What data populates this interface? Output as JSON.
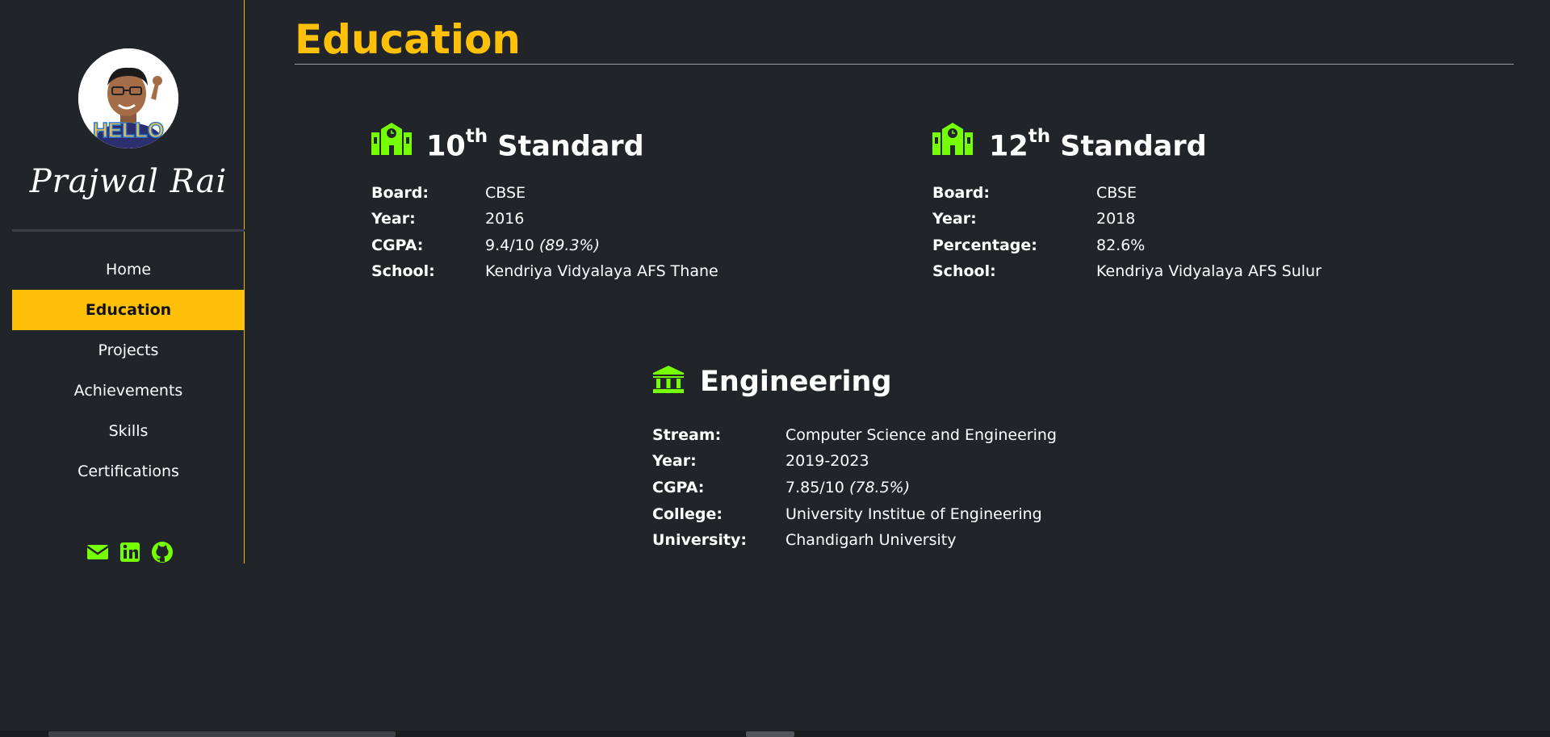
{
  "sidebar": {
    "name": "Prajwal Rai",
    "avatar_label": "HELLO",
    "nav": [
      {
        "label": "Home"
      },
      {
        "label": "Education"
      },
      {
        "label": "Projects"
      },
      {
        "label": "Achievements"
      },
      {
        "label": "Skills"
      },
      {
        "label": "Certifications"
      }
    ],
    "active_nav": "Education",
    "social_icons": [
      "envelope-icon",
      "linkedin-icon",
      "github-icon"
    ]
  },
  "page": {
    "title": "Education"
  },
  "education": {
    "tenth": {
      "title_number": "10",
      "title_sup": "th",
      "title_rest": " Standard",
      "rows": [
        {
          "label": "Board:",
          "value": "CBSE",
          "extra": ""
        },
        {
          "label": "Year:",
          "value": "2016",
          "extra": ""
        },
        {
          "label": "CGPA:",
          "value": "9.4/10 ",
          "extra": "(89.3%)"
        },
        {
          "label": "School:",
          "value": "Kendriya Vidyalaya AFS Thane",
          "extra": ""
        }
      ]
    },
    "twelfth": {
      "title_number": "12",
      "title_sup": "th",
      "title_rest": " Standard",
      "rows": [
        {
          "label": "Board:",
          "value": "CBSE",
          "extra": ""
        },
        {
          "label": "Year:",
          "value": "2018",
          "extra": ""
        },
        {
          "label": "Percentage:",
          "value": "82.6%",
          "extra": ""
        },
        {
          "label": "School:",
          "value": "Kendriya Vidyalaya AFS Sulur",
          "extra": ""
        }
      ]
    },
    "engineering": {
      "title": "Engineering",
      "rows": [
        {
          "label": "Stream:",
          "value": "Computer Science and Engineering",
          "extra": ""
        },
        {
          "label": "Year:",
          "value": "2019-2023",
          "extra": ""
        },
        {
          "label": "CGPA:",
          "value": "7.85/10 ",
          "extra": "(78.5%)"
        },
        {
          "label": "College:",
          "value": "University Institue of Engineering",
          "extra": ""
        },
        {
          "label": "University:",
          "value": "Chandigarh University",
          "extra": ""
        }
      ]
    }
  },
  "colors": {
    "background": "#212429",
    "accent": "#ffc107",
    "icon_green": "#76ff03",
    "text": "#ffffff"
  }
}
